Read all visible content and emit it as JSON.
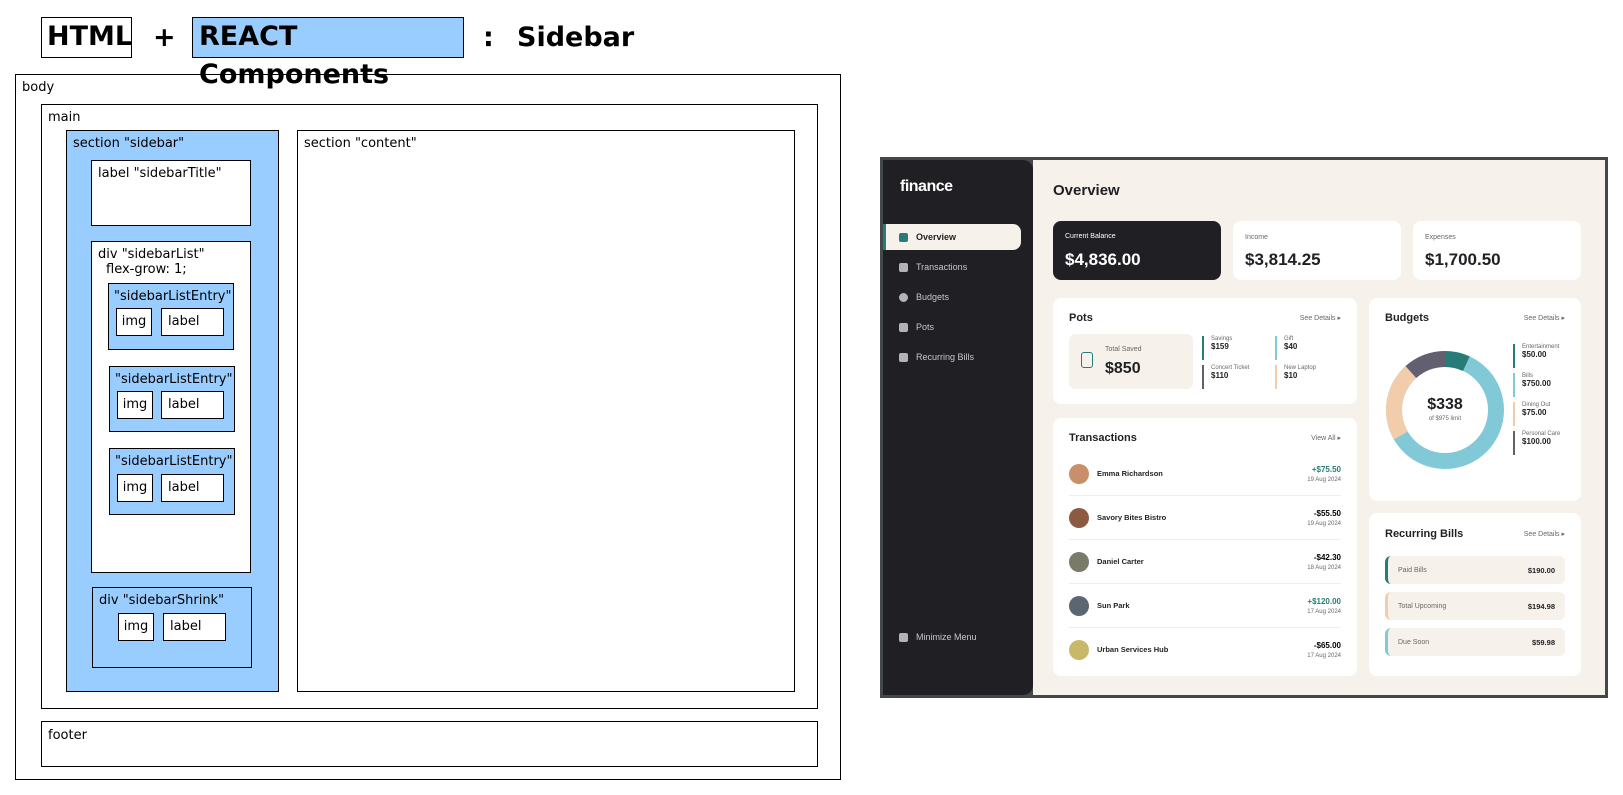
{
  "header": {
    "html": "HTML",
    "plus": "+",
    "react": "REACT Components",
    "colon": ":",
    "topic": "Sidebar"
  },
  "diagram": {
    "body": "body",
    "main": "main",
    "sidebar": "section \"sidebar\"",
    "content": "section \"content\"",
    "sidebar_title": "label \"sidebarTitle\"",
    "sidebar_list": "div \"sidebarList\"",
    "flex_grow": "flex-grow: 1;",
    "entry": "\"sidebarListEntry\"",
    "img": "img",
    "label": "label",
    "shrink": "div \"sidebarShrink\"",
    "footer": "footer"
  },
  "mock": {
    "logo": "finance",
    "nav": [
      {
        "label": "Overview",
        "icon": "home-icon"
      },
      {
        "label": "Transactions",
        "icon": "arrows-icon"
      },
      {
        "label": "Budgets",
        "icon": "pie-icon"
      },
      {
        "label": "Pots",
        "icon": "jar-icon"
      },
      {
        "label": "Recurring Bills",
        "icon": "receipt-icon"
      }
    ],
    "minimize": "Minimize Menu",
    "page_title": "Overview",
    "summary": [
      {
        "label": "Current Balance",
        "value": "$4,836.00"
      },
      {
        "label": "Income",
        "value": "$3,814.25"
      },
      {
        "label": "Expenses",
        "value": "$1,700.50"
      }
    ],
    "pots": {
      "title": "Pots",
      "link": "See Details",
      "total_label": "Total Saved",
      "total": "$850",
      "items": [
        {
          "name": "Savings",
          "value": "$159",
          "color": "#277c78"
        },
        {
          "name": "Gift",
          "value": "$40",
          "color": "#82c9d7"
        },
        {
          "name": "Concert Ticket",
          "value": "$110",
          "color": "#626070"
        },
        {
          "name": "New Laptop",
          "value": "$10",
          "color": "#f2cdac"
        }
      ]
    },
    "transactions": {
      "title": "Transactions",
      "link": "View All",
      "rows": [
        {
          "name": "Emma Richardson",
          "amount": "+$75.50",
          "date": "19 Aug 2024",
          "color": "#277c78",
          "avatar": "#c98e6a"
        },
        {
          "name": "Savory Bites Bistro",
          "amount": "-$55.50",
          "date": "19 Aug 2024",
          "color": "#201f24",
          "avatar": "#8c5a40"
        },
        {
          "name": "Daniel Carter",
          "amount": "-$42.30",
          "date": "18 Aug 2024",
          "color": "#201f24",
          "avatar": "#7a7a6a"
        },
        {
          "name": "Sun Park",
          "amount": "+$120.00",
          "date": "17 Aug 2024",
          "color": "#277c78",
          "avatar": "#5a6670"
        },
        {
          "name": "Urban Services Hub",
          "amount": "-$65.00",
          "date": "17 Aug 2024",
          "color": "#201f24",
          "avatar": "#c9b86a"
        }
      ]
    },
    "budgets": {
      "title": "Budgets",
      "link": "See Details",
      "center": "$338",
      "sub": "of $975 limit",
      "items": [
        {
          "name": "Entertainment",
          "value": "$50.00",
          "color": "#277c78"
        },
        {
          "name": "Bills",
          "value": "$750.00",
          "color": "#82c9d7"
        },
        {
          "name": "Dining Out",
          "value": "$75.00",
          "color": "#f2cdac"
        },
        {
          "name": "Personal Care",
          "value": "$100.00",
          "color": "#626070"
        }
      ]
    },
    "bills": {
      "title": "Recurring Bills",
      "link": "See Details",
      "rows": [
        {
          "name": "Paid Bills",
          "value": "$190.00",
          "color": "#277c78"
        },
        {
          "name": "Total Upcoming",
          "value": "$194.98",
          "color": "#f2cdac"
        },
        {
          "name": "Due Soon",
          "value": "$59.98",
          "color": "#82c9d7"
        }
      ]
    }
  }
}
